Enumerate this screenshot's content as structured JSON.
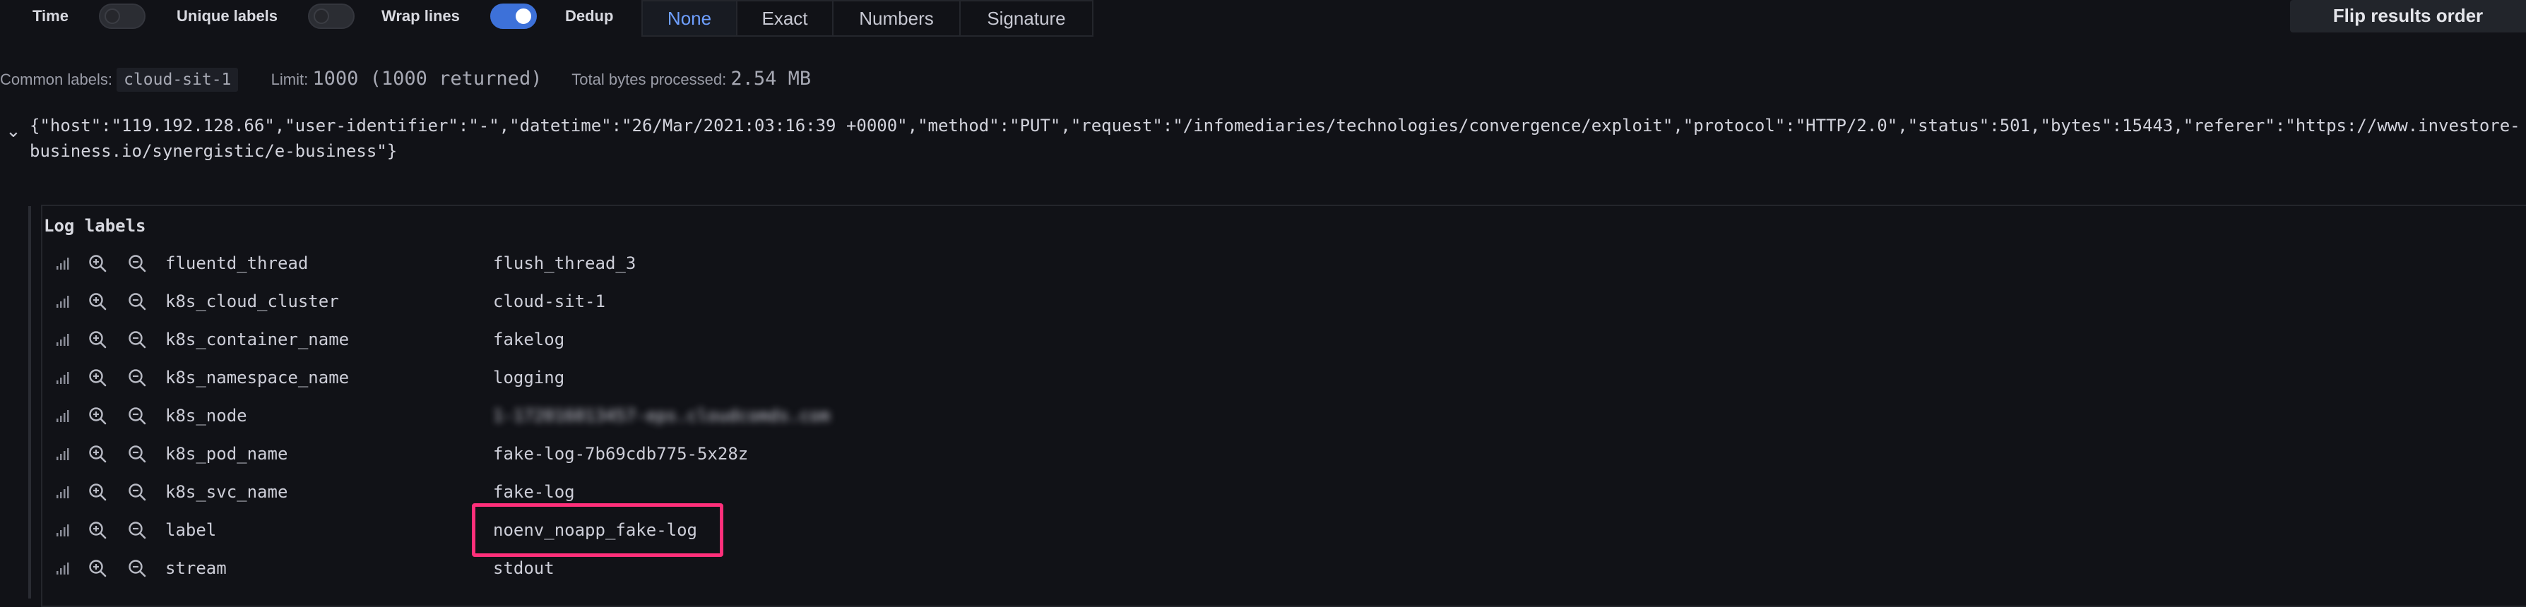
{
  "options": {
    "time_label": "Time",
    "time_on": false,
    "unique_labels_label": "Unique labels",
    "unique_labels_on": false,
    "wrap_lines_label": "Wrap lines",
    "wrap_lines_on": false,
    "dedup_label": "Dedup",
    "dedup_on": true,
    "dedup_modes": [
      "None",
      "Exact",
      "Numbers",
      "Signature"
    ],
    "dedup_selected": "None",
    "flip_label": "Flip results order"
  },
  "meta": {
    "common_labels_label": "Common labels:",
    "common_labels_value": "cloud-sit-1",
    "limit_label": "Limit:",
    "limit_value": "1000 (1000 returned)",
    "bytes_label": "Total bytes processed:",
    "bytes_value": "2.54 MB"
  },
  "log_line": "{\"host\":\"119.192.128.66\",\"user-identifier\":\"-\",\"datetime\":\"26/Mar/2021:03:16:39 +0000\",\"method\":\"PUT\",\"request\":\"/infomediaries/technologies/convergence/exploit\",\"protocol\":\"HTTP/2.0\",\"status\":501,\"bytes\":15443,\"referer\":\"https://www.investore-business.io/synergistic/e-business\"}",
  "details": {
    "title": "Log labels",
    "labels": [
      {
        "key": "fluentd_thread",
        "value": "flush_thread_3"
      },
      {
        "key": "k8s_cloud_cluster",
        "value": "cloud-sit-1"
      },
      {
        "key": "k8s_container_name",
        "value": "fakelog"
      },
      {
        "key": "k8s_namespace_name",
        "value": "logging"
      },
      {
        "key": "k8s_node",
        "value": "1-172016013457-eps.cloudcomds.com"
      },
      {
        "key": "k8s_pod_name",
        "value": "fake-log-7b69cdb775-5x28z"
      },
      {
        "key": "k8s_svc_name",
        "value": "fake-log"
      },
      {
        "key": "label",
        "value": "noenv_noapp_fake-log"
      },
      {
        "key": "stream",
        "value": "stdout"
      }
    ]
  },
  "colors": {
    "accent": "#3d71d9",
    "active_text": "#6e9fff",
    "highlight": "#ff2f7a",
    "background": "#111217"
  },
  "icons": [
    "stats-icon",
    "zoom-in-icon",
    "zoom-out-icon",
    "chevron-down-icon"
  ]
}
